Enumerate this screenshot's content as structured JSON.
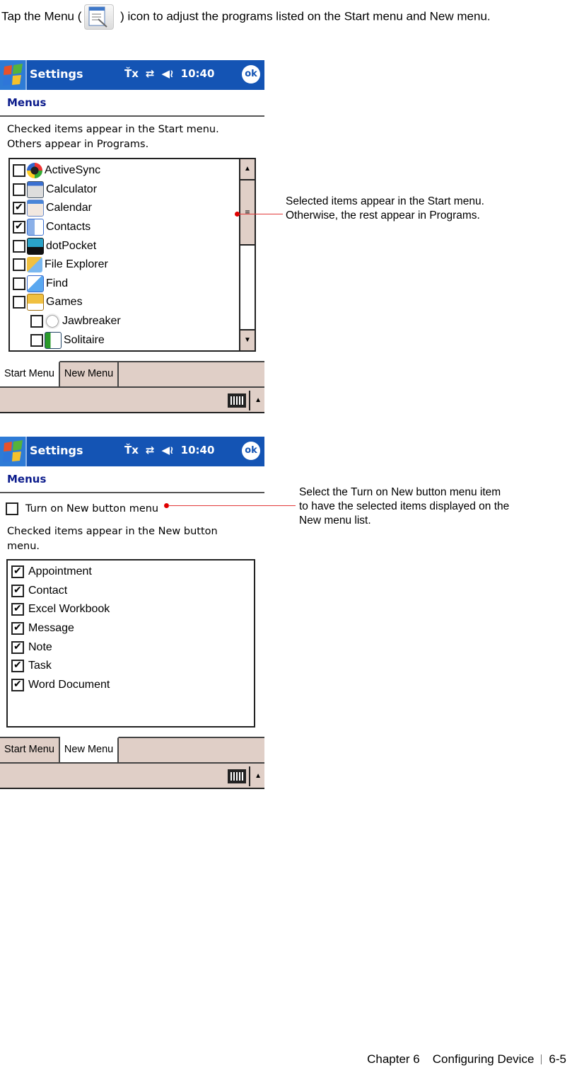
{
  "intro": {
    "before_icon": "Tap the Menu (",
    "icon": "menu-settings-icon",
    "after_icon": " ) icon to adjust the programs listed on the Start menu and New menu."
  },
  "screens": [
    {
      "titlebar": {
        "title": "Settings",
        "time": "10:40",
        "ok_label": "ok",
        "tray_icons": [
          "signal-off-icon",
          "connectivity-icon",
          "volume-icon"
        ]
      },
      "section_title": "Menus",
      "description": [
        "Checked items appear in the Start menu.",
        "Others appear in Programs."
      ],
      "list": [
        {
          "label": "ActiveSync",
          "checked": false,
          "icon": "activesync-icon",
          "indent": 0
        },
        {
          "label": "Calculator",
          "checked": false,
          "icon": "calculator-icon",
          "indent": 0
        },
        {
          "label": "Calendar",
          "checked": true,
          "icon": "calendar-icon",
          "indent": 0
        },
        {
          "label": "Contacts",
          "checked": true,
          "icon": "contacts-icon",
          "indent": 0
        },
        {
          "label": "dotPocket",
          "checked": false,
          "icon": "dotpocket-icon",
          "indent": 0
        },
        {
          "label": "File Explorer",
          "checked": false,
          "icon": "file-explorer-icon",
          "indent": 0
        },
        {
          "label": "Find",
          "checked": false,
          "icon": "find-icon",
          "indent": 0
        },
        {
          "label": "Games",
          "checked": false,
          "icon": "games-folder-icon",
          "indent": 0
        },
        {
          "label": "Jawbreaker",
          "checked": false,
          "icon": "jawbreaker-icon",
          "indent": 1
        },
        {
          "label": "Solitaire",
          "checked": false,
          "icon": "solitaire-icon",
          "indent": 1
        }
      ],
      "tabs": [
        {
          "label": "Start Menu",
          "active": true
        },
        {
          "label": "New Menu",
          "active": false
        }
      ],
      "callout": "Selected items appear in the Start menu. Otherwise, the rest appear in Programs."
    },
    {
      "titlebar": {
        "title": "Settings",
        "time": "10:40",
        "ok_label": "ok",
        "tray_icons": [
          "signal-off-icon",
          "connectivity-icon",
          "volume-icon"
        ]
      },
      "section_title": "Menus",
      "toggle": {
        "label": "Turn on New button menu",
        "checked": false
      },
      "description": [
        "Checked items appear in the New button",
        "menu."
      ],
      "list": [
        {
          "label": "Appointment",
          "checked": true
        },
        {
          "label": "Contact",
          "checked": true
        },
        {
          "label": "Excel Workbook",
          "checked": true
        },
        {
          "label": "Message",
          "checked": true
        },
        {
          "label": "Note",
          "checked": true
        },
        {
          "label": "Task",
          "checked": true
        },
        {
          "label": "Word Document",
          "checked": true
        }
      ],
      "tabs": [
        {
          "label": "Start Menu",
          "active": false
        },
        {
          "label": "New Menu",
          "active": true
        }
      ],
      "callout": "Select the Turn on New button menu item to have the selected items displayed on the New menu list."
    }
  ],
  "footer": {
    "chapter": "Chapter 6",
    "section": "Configuring Device",
    "page": "6-5"
  }
}
